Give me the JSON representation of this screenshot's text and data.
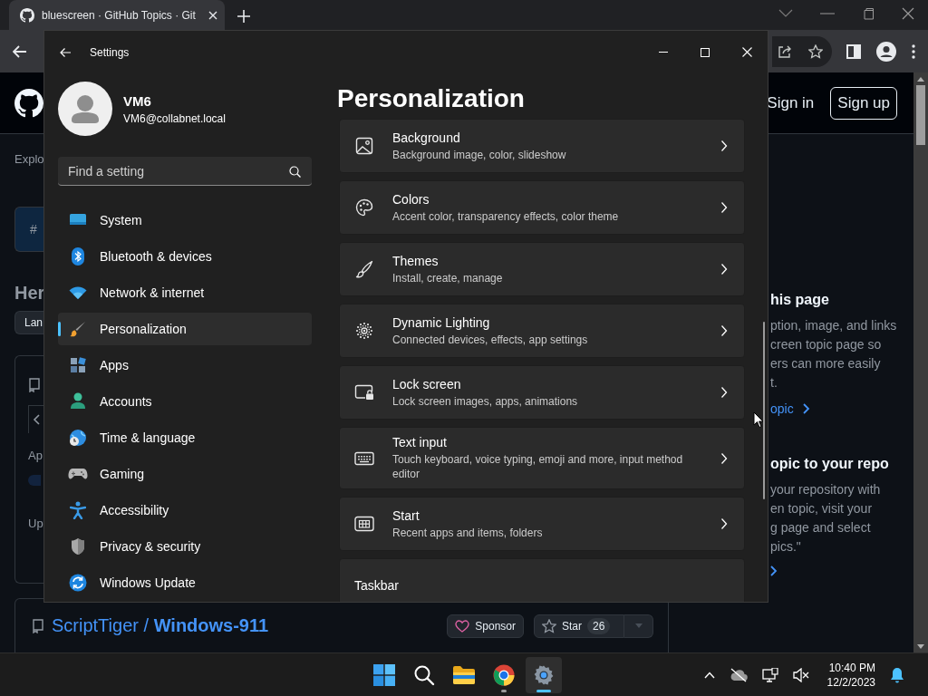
{
  "browser": {
    "tab": {
      "title": "bluescreen · GitHub Topics · Git",
      "selected": true
    },
    "header": {
      "sign_in": "Sign in",
      "sign_up": "Sign up"
    },
    "left_column": {
      "explore": "Explo",
      "topic_tag": "#",
      "heading": "Her",
      "filter": "Lan",
      "list_items": [
        "Ap",
        "Up"
      ]
    },
    "right_column": {
      "sections": [
        {
          "heading": "his page",
          "lines": [
            "ption, image, and links",
            "creen topic page so",
            "ers can more easily",
            "t."
          ],
          "link": "opic"
        },
        {
          "heading": "opic to your repo",
          "lines": [
            "your repository with",
            "en topic, visit your",
            "g page and select",
            "pics.\""
          ]
        }
      ]
    },
    "repo": {
      "title": "ScriptTiger / **Windows-911**",
      "sponsor": "Sponsor",
      "star": "Star",
      "star_count": "26"
    }
  },
  "settings": {
    "title": "Settings",
    "user": {
      "name": "VM6",
      "email": "VM6@collabnet.local"
    },
    "search": {
      "placeholder": "Find a setting"
    },
    "nav": [
      {
        "label": "System",
        "selected": false
      },
      {
        "label": "Bluetooth & devices",
        "selected": false
      },
      {
        "label": "Network & internet",
        "selected": false
      },
      {
        "label": "Personalization",
        "selected": true
      },
      {
        "label": "Apps",
        "selected": false
      },
      {
        "label": "Accounts",
        "selected": false
      },
      {
        "label": "Time & language",
        "selected": false
      },
      {
        "label": "Gaming",
        "selected": false
      },
      {
        "label": "Accessibility",
        "selected": false
      },
      {
        "label": "Privacy & security",
        "selected": false
      },
      {
        "label": "Windows Update",
        "selected": false
      }
    ],
    "page_title": "Personalization",
    "cards": [
      {
        "title": "Background",
        "description": "Background image, color, slideshow"
      },
      {
        "title": "Colors",
        "description": "Accent color, transparency effects, color theme"
      },
      {
        "title": "Themes",
        "description": "Install, create, manage"
      },
      {
        "title": "Dynamic Lighting",
        "description": "Connected devices, effects, app settings"
      },
      {
        "title": "Lock screen",
        "description": "Lock screen images, apps, animations"
      },
      {
        "title": "Text input",
        "description": "Touch keyboard, voice typing, emoji and more, input method editor"
      },
      {
        "title": "Start",
        "description": "Recent apps and items, folders"
      },
      {
        "title": "Taskbar"
      }
    ]
  },
  "taskbar": {
    "apps": [
      {
        "kind": "start",
        "running": false,
        "selected": false
      },
      {
        "kind": "search",
        "running": false,
        "selected": false
      },
      {
        "kind": "files",
        "running": false,
        "selected": false
      },
      {
        "kind": "browser",
        "running": true,
        "selected": false
      },
      {
        "kind": "settings",
        "running": true,
        "selected": true
      }
    ],
    "clock": {
      "time": "10:40 PM",
      "date": "12/2/2023"
    }
  }
}
